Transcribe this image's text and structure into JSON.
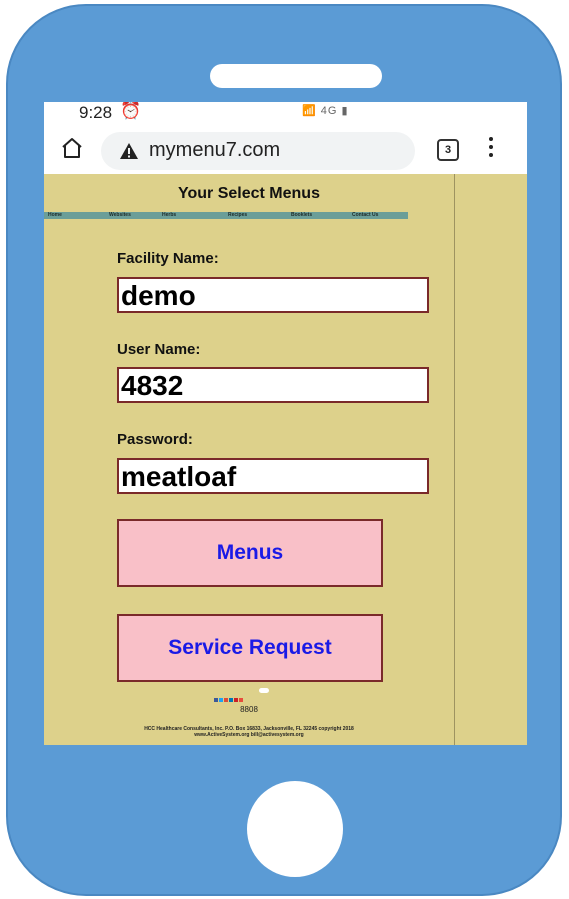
{
  "status_bar": {
    "time": "9:28",
    "alarm_icon": "alarm-icon",
    "network": "4G"
  },
  "browser": {
    "url": "mymenu7.com",
    "tab_count": "3",
    "home_icon": "home-icon",
    "warning_icon": "warning-icon",
    "menu_icon": "more-vert-icon"
  },
  "page": {
    "title": "Your Select Menus",
    "nav": [
      "Home",
      "Websites",
      "Herbs",
      "Recipes",
      "Booklets",
      "Contact Us"
    ],
    "facility_label": "Facility Name:",
    "facility_value": "demo",
    "user_label": "User Name:",
    "user_value": "4832",
    "password_label": "Password:",
    "password_value": "meatloaf",
    "menus_button": "Menus",
    "service_button": "Service Request",
    "counter": "8808",
    "footer_line1": "HCC Healthcare Consultants, Inc. P.O. Box 16833, Jacksonville, FL 32245 copyright 2018",
    "footer_line2": "www.ActiveSystem.org bill@activesystem.org"
  },
  "colors": {
    "phone_frame": "#5b9bd5",
    "page_background": "#ddd18b",
    "nav_bar": "#6b9e98",
    "button_fill": "#f9c0c8",
    "button_text": "#1a1ae6",
    "field_border": "#7a2a2a"
  }
}
